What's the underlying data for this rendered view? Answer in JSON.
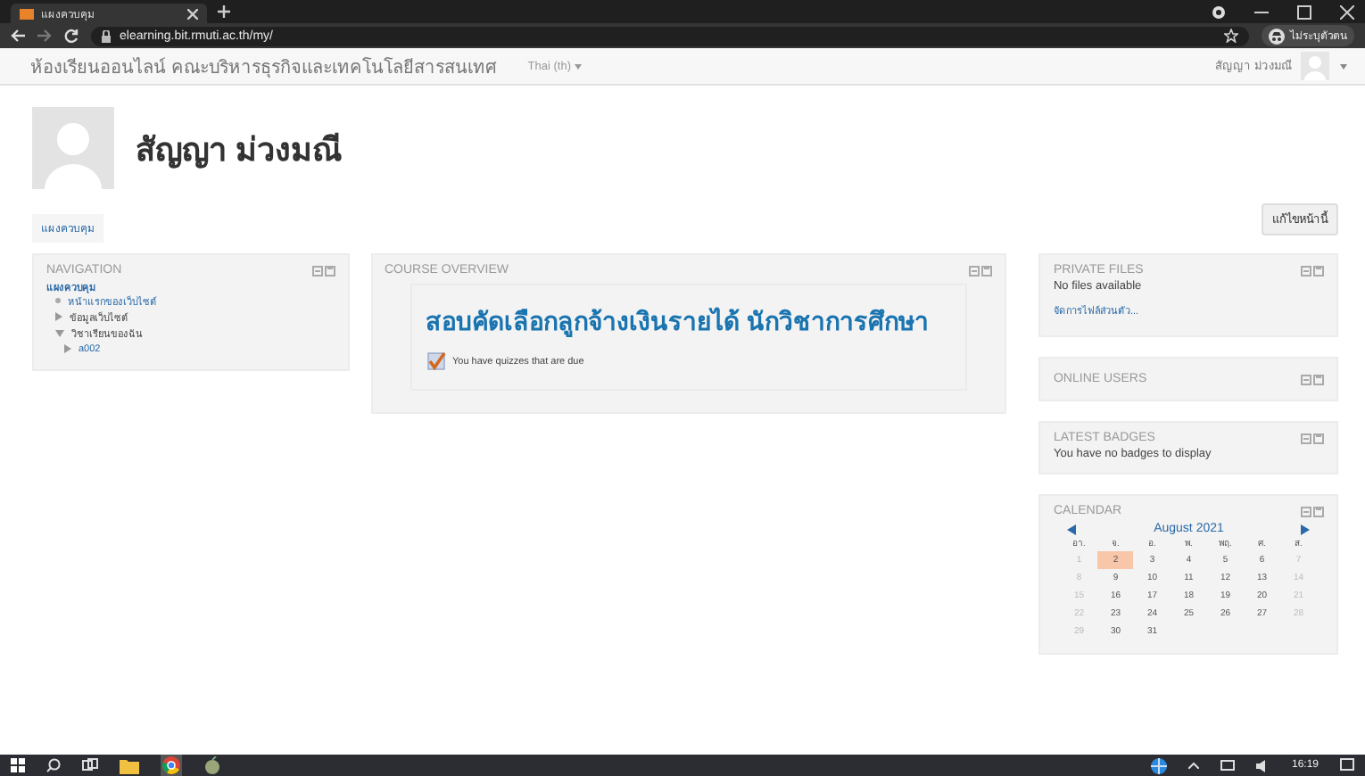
{
  "browser": {
    "tab_title": "แผงควบคุม",
    "url": "elearning.bit.rmuti.ac.th/my/",
    "profile_label": "ไม่ระบุตัวตน"
  },
  "navbar": {
    "brand": "ห้องเรียนออนไลน์ คณะบริหารธุรกิจและเทคโนโลยีสารสนเทศ",
    "language": "Thai (th)",
    "user_name": "สัญญา ม่วงมณี"
  },
  "header": {
    "full_name": "สัญญา ม่วงมณี",
    "breadcrumb": "แผงควบคุม",
    "edit_button": "แก้ไขหน้านี้"
  },
  "navigation": {
    "title": "NAVIGATION",
    "items": [
      {
        "label": "แผงควบคุม",
        "kind": "root",
        "children": [
          {
            "label": "หน้าแรกของเว็บไซต์",
            "kind": "leaf"
          },
          {
            "label": "ข้อมูลเว็บไซต์",
            "kind": "branch",
            "expanded": false
          },
          {
            "label": "วิชาเรียนของฉัน",
            "kind": "branch",
            "expanded": true,
            "children": [
              {
                "label": "a002",
                "kind": "branch",
                "expanded": false
              }
            ]
          }
        ]
      }
    ]
  },
  "course_overview": {
    "title": "COURSE OVERVIEW",
    "course_name": "สอบคัดเลือกลูกจ้างเงินรายได้ นักวิชาการศึกษา",
    "notice": "You have quizzes that are due"
  },
  "private_files": {
    "title": "PRIVATE FILES",
    "message": "No files available",
    "link": "จัดการไฟล์ส่วนตัว..."
  },
  "online_users": {
    "title": "ONLINE USERS"
  },
  "latest_badges": {
    "title": "LATEST BADGES",
    "message": "You have no badges to display"
  },
  "calendar": {
    "title": "CALENDAR",
    "month": "August 2021",
    "weekdays": [
      "อา.",
      "จ.",
      "อ.",
      "พ.",
      "พฤ.",
      "ศ.",
      "ส."
    ],
    "weeks": [
      [
        {
          "day": "1",
          "today": false
        },
        {
          "day": "2",
          "today": true
        },
        {
          "day": "3",
          "today": false
        },
        {
          "day": "4",
          "today": false
        },
        {
          "day": "5",
          "today": false
        },
        {
          "day": "6",
          "today": false
        },
        {
          "day": "7",
          "today": false
        }
      ],
      [
        {
          "day": "8",
          "today": false
        },
        {
          "day": "9",
          "today": false
        },
        {
          "day": "10",
          "today": false
        },
        {
          "day": "11",
          "today": false
        },
        {
          "day": "12",
          "today": false
        },
        {
          "day": "13",
          "today": false
        },
        {
          "day": "14",
          "today": false
        }
      ],
      [
        {
          "day": "15",
          "today": false
        },
        {
          "day": "16",
          "today": false
        },
        {
          "day": "17",
          "today": false
        },
        {
          "day": "18",
          "today": false
        },
        {
          "day": "19",
          "today": false
        },
        {
          "day": "20",
          "today": false
        },
        {
          "day": "21",
          "today": false
        }
      ],
      [
        {
          "day": "22",
          "today": false
        },
        {
          "day": "23",
          "today": false
        },
        {
          "day": "24",
          "today": false
        },
        {
          "day": "25",
          "today": false
        },
        {
          "day": "26",
          "today": false
        },
        {
          "day": "27",
          "today": false
        },
        {
          "day": "28",
          "today": false
        }
      ],
      [
        {
          "day": "29",
          "today": false
        },
        {
          "day": "30",
          "today": false
        },
        {
          "day": "31",
          "today": false
        }
      ]
    ]
  },
  "taskbar": {
    "time": "16:19"
  }
}
